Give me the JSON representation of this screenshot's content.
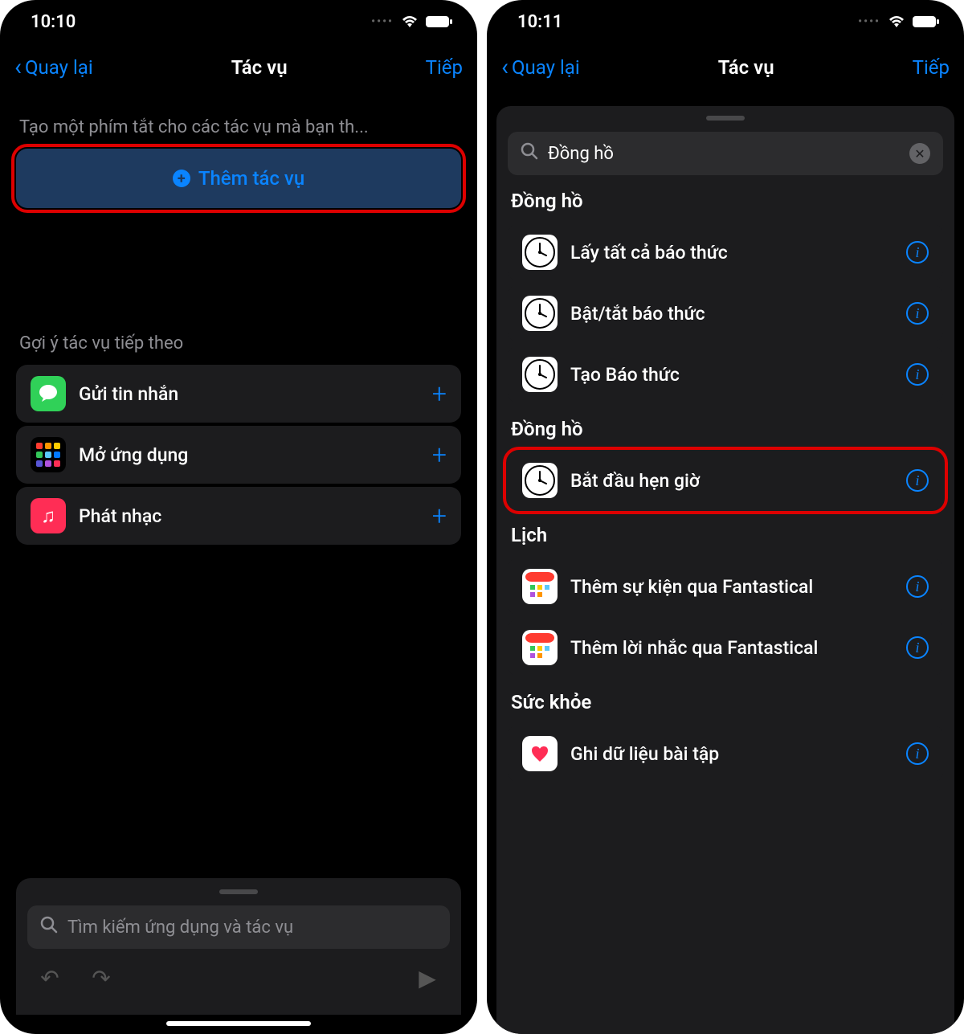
{
  "left": {
    "status_time": "10:10",
    "back_label": "Quay lại",
    "title": "Tác vụ",
    "next_label": "Tiếp",
    "hint": "Tạo một phím tắt cho các tác vụ mà bạn th...",
    "add_task_label": "Thêm tác vụ",
    "suggestions_header": "Gợi ý tác vụ tiếp theo",
    "suggestions": [
      {
        "label": "Gửi tin nhắn",
        "icon": "messages"
      },
      {
        "label": "Mở ứng dụng",
        "icon": "grid"
      },
      {
        "label": "Phát nhạc",
        "icon": "music"
      }
    ],
    "search_placeholder": "Tìm kiếm ứng dụng và tác vụ"
  },
  "right": {
    "status_time": "10:11",
    "back_label": "Quay lại",
    "title": "Tác vụ",
    "next_label": "Tiếp",
    "search_value": "Đồng hồ",
    "sections": [
      {
        "header": "Đồng hồ",
        "items": [
          {
            "label": "Lấy tất cả báo thức",
            "icon": "clock",
            "highlight": false
          },
          {
            "label": "Bật/tắt báo thức",
            "icon": "clock",
            "highlight": false
          },
          {
            "label": "Tạo Báo thức",
            "icon": "clock",
            "highlight": false
          }
        ]
      },
      {
        "header": "Đồng hồ",
        "items": [
          {
            "label": "Bắt đầu hẹn giờ",
            "icon": "clock",
            "highlight": true
          }
        ]
      },
      {
        "header": "Lịch",
        "items": [
          {
            "label": "Thêm sự kiện qua Fantastical",
            "icon": "fantastical",
            "highlight": false
          },
          {
            "label": "Thêm lời nhắc qua Fantastical",
            "icon": "fantastical",
            "highlight": false
          }
        ]
      },
      {
        "header": "Sức khỏe",
        "items": [
          {
            "label": "Ghi dữ liệu bài tập",
            "icon": "health",
            "highlight": false
          }
        ]
      }
    ]
  }
}
